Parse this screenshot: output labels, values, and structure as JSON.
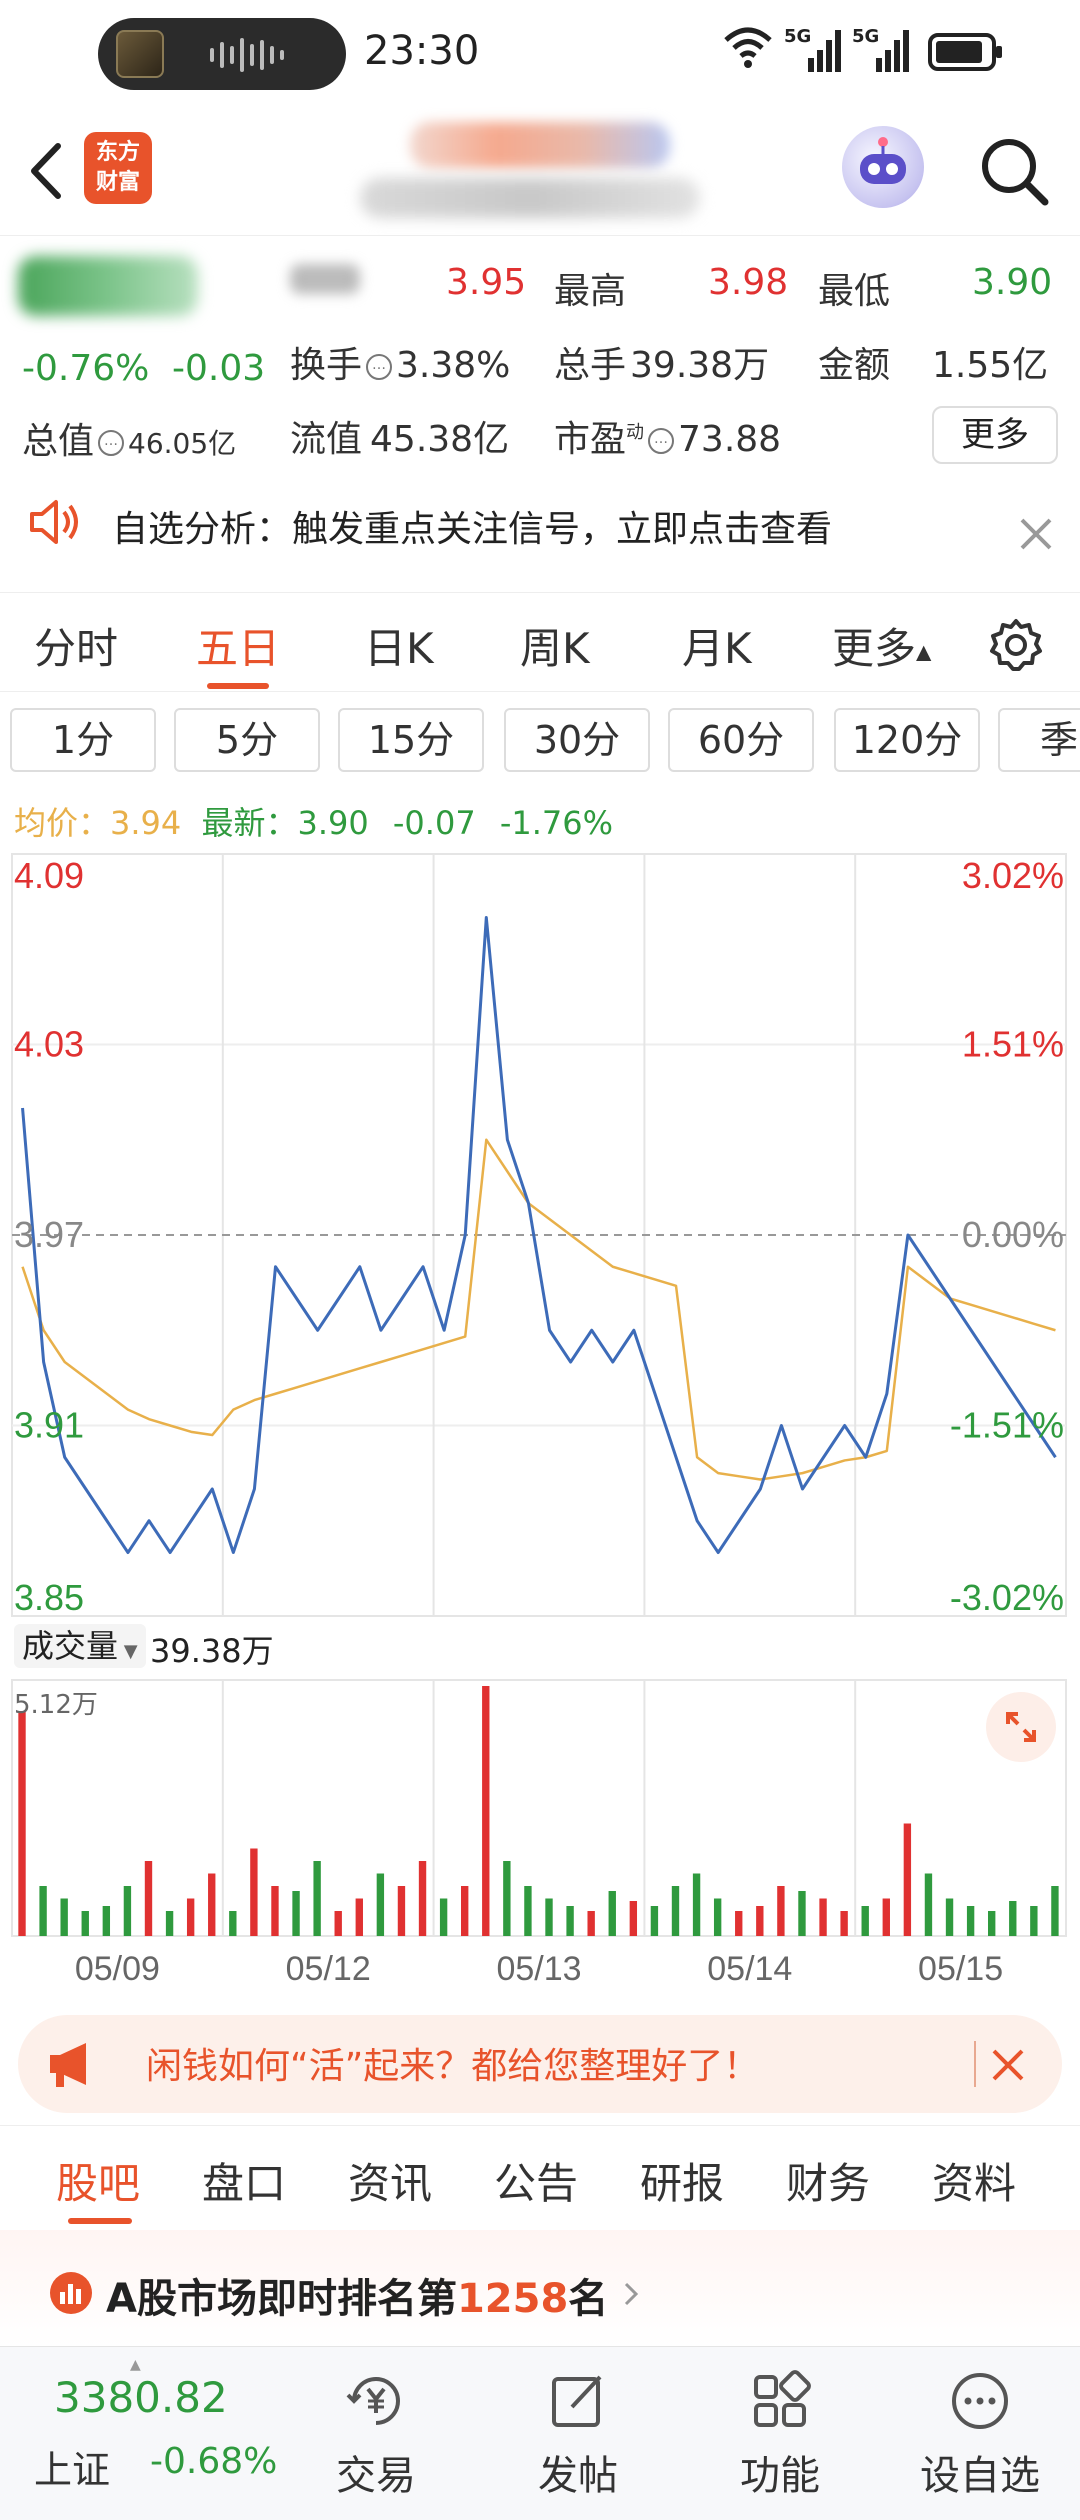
{
  "status": {
    "time": "23:30",
    "net1": "5G",
    "net2": "5G"
  },
  "header": {
    "logo_line1": "东方",
    "logo_line2": "财富"
  },
  "quote": {
    "change_pct": "-0.76%",
    "change": "-0.03",
    "open_label": "今开",
    "open": "3.95",
    "high_label": "最高",
    "high": "3.98",
    "low_label": "最低",
    "low": "3.90",
    "turnover_label": "换手",
    "turnover": "3.38%",
    "volume_label": "总手",
    "volume": "39.38万",
    "amount_label": "金额",
    "amount": "1.55亿",
    "mktcap_label": "总值",
    "mktcap": "46.05亿",
    "float_label": "流值",
    "float": "45.38亿",
    "pe_label": "市盈",
    "pe_sup": "动",
    "pe": "73.88",
    "more": "更多"
  },
  "alert": {
    "text": "自选分析：触发重点关注信号，立即点击查看"
  },
  "tabs": [
    {
      "label": "分时"
    },
    {
      "label": "五日"
    },
    {
      "label": "日K"
    },
    {
      "label": "周K"
    },
    {
      "label": "月K"
    },
    {
      "label": "更多"
    }
  ],
  "periods": [
    "1分",
    "5分",
    "15分",
    "30分",
    "60分",
    "120分",
    "季"
  ],
  "avgline": {
    "avg_label": "均价：",
    "avg": "3.94",
    "last_label": "最新：",
    "last": "3.90",
    "chg": "-0.07",
    "pct": "-1.76%"
  },
  "chart_data": {
    "type": "line",
    "days": [
      "05/09",
      "05/12",
      "05/13",
      "05/14",
      "05/15"
    ],
    "price_ticks": [
      "4.09",
      "4.03",
      "3.97",
      "3.91",
      "3.85"
    ],
    "pct_ticks": [
      "3.02%",
      "1.51%",
      "0.00%",
      "-1.51%",
      "-3.02%"
    ],
    "ylim": [
      3.85,
      4.09
    ],
    "prev_close": 3.97,
    "series": [
      {
        "values": [
          4.01,
          3.93,
          3.9,
          3.89,
          3.88,
          3.87,
          3.88,
          3.87,
          3.88,
          3.89,
          3.87,
          3.89,
          3.96,
          3.95,
          3.94,
          3.95,
          3.96,
          3.94,
          3.95,
          3.96,
          3.94,
          3.97,
          4.07,
          4.0,
          3.98,
          3.94,
          3.93,
          3.94,
          3.93,
          3.94,
          3.92,
          3.9,
          3.88,
          3.87,
          3.88,
          3.89,
          3.91,
          3.89,
          3.9,
          3.91,
          3.9,
          3.92,
          3.97,
          3.96,
          3.95,
          3.94,
          3.93,
          3.92,
          3.91,
          3.9
        ]
      },
      {
        "values": [
          3.96,
          3.94,
          3.93,
          3.925,
          3.92,
          3.915,
          3.912,
          3.91,
          3.908,
          3.907,
          3.915,
          3.918,
          3.92,
          3.922,
          3.924,
          3.926,
          3.928,
          3.93,
          3.932,
          3.934,
          3.936,
          3.938,
          4.0,
          3.99,
          3.98,
          3.975,
          3.97,
          3.965,
          3.96,
          3.958,
          3.956,
          3.954,
          3.9,
          3.895,
          3.894,
          3.893,
          3.894,
          3.895,
          3.897,
          3.899,
          3.9,
          3.902,
          3.96,
          3.955,
          3.95,
          3.948,
          3.946,
          3.944,
          3.942,
          3.94
        ]
      }
    ],
    "volume_label": "成交量",
    "volume_value": "39.38万",
    "volume_max_label": "5.12万",
    "volume": [
      0.9,
      0.2,
      0.15,
      0.1,
      0.12,
      0.2,
      0.3,
      0.1,
      0.15,
      0.25,
      0.1,
      0.35,
      0.2,
      0.18,
      0.3,
      0.1,
      0.15,
      0.25,
      0.2,
      0.3,
      0.15,
      0.2,
      1.0,
      0.3,
      0.2,
      0.15,
      0.12,
      0.1,
      0.18,
      0.14,
      0.12,
      0.2,
      0.25,
      0.15,
      0.1,
      0.12,
      0.2,
      0.18,
      0.15,
      0.1,
      0.12,
      0.15,
      0.45,
      0.25,
      0.15,
      0.12,
      0.1,
      0.14,
      0.12,
      0.2
    ]
  },
  "ad": {
    "text": "闲钱如何“活”起来？都给您整理好了！"
  },
  "btabs": [
    "股吧",
    "盘口",
    "资讯",
    "公告",
    "研报",
    "财务",
    "资料"
  ],
  "rank": {
    "prefix": "A股市场即时排名第",
    "num": "1258",
    "suffix": "名"
  },
  "nav": {
    "index_value": "3380.82",
    "index_name": "上证",
    "index_pct": "-0.68%",
    "items": [
      {
        "label": "交易"
      },
      {
        "label": "发帖"
      },
      {
        "label": "功能"
      },
      {
        "label": "设自选"
      }
    ]
  },
  "colors": {
    "up": "#e03131",
    "down": "#2f9a3e",
    "price_line": "#3d6bb8",
    "avg_line": "#e8b04a",
    "accent": "#e8532b"
  }
}
